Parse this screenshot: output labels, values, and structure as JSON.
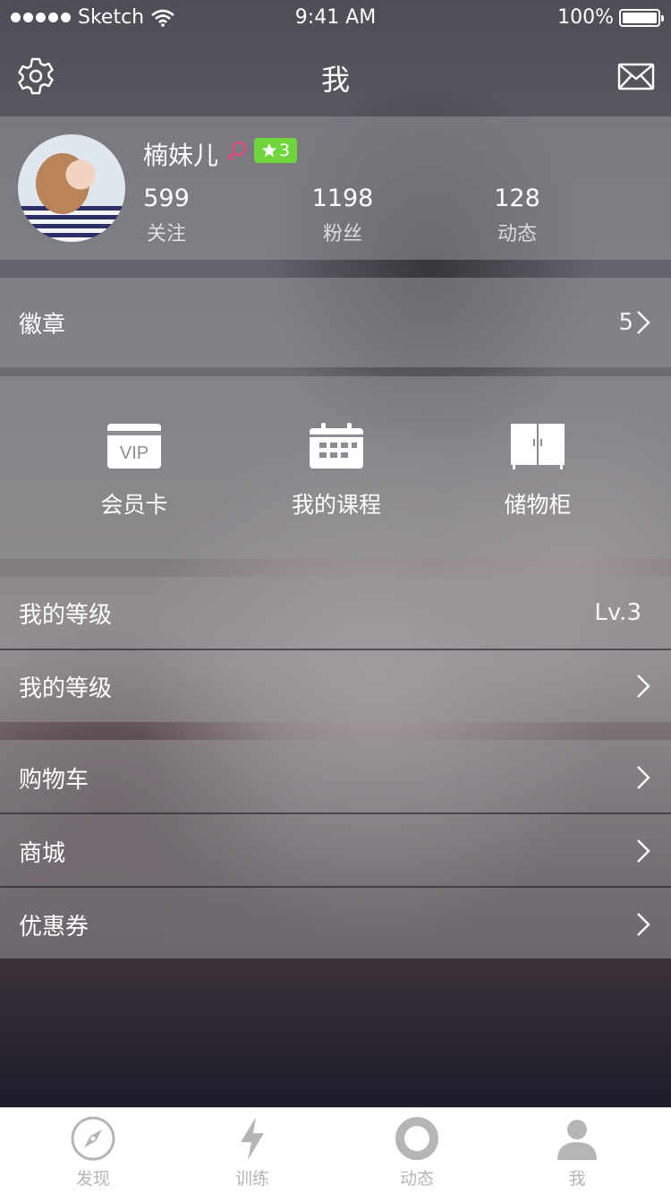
{
  "status_bar": {
    "carrier": "Sketch",
    "time": "9:41 AM",
    "battery": "100%"
  },
  "nav": {
    "title": "我",
    "left_icon": "gear-icon",
    "right_icon": "mail-icon"
  },
  "profile": {
    "name": "楠妹儿",
    "gender_icon": "female-icon",
    "level_badge": "3",
    "stats": [
      {
        "value": "599",
        "label": "关注"
      },
      {
        "value": "1198",
        "label": "粉丝"
      },
      {
        "value": "128",
        "label": "动态"
      }
    ]
  },
  "badges": {
    "label": "徽章",
    "count": "5"
  },
  "grid": [
    {
      "label": "会员卡",
      "icon": "vip-card-icon",
      "icon_text": "VIP"
    },
    {
      "label": "我的课程",
      "icon": "calendar-icon"
    },
    {
      "label": "储物柜",
      "icon": "locker-icon"
    }
  ],
  "level_rows": [
    {
      "label": "我的等级",
      "value": "Lv.3"
    },
    {
      "label": "我的等级"
    }
  ],
  "shop_rows": [
    {
      "label": "购物车"
    },
    {
      "label": "商城"
    },
    {
      "label": "优惠券"
    }
  ],
  "tabbar": [
    {
      "label": "发现",
      "icon": "compass-icon"
    },
    {
      "label": "训练",
      "icon": "lightning-icon"
    },
    {
      "label": "动态",
      "icon": "ring-icon"
    },
    {
      "label": "我",
      "icon": "person-icon"
    }
  ],
  "colors": {
    "badge_green": "#6ed63b",
    "gender_pink": "#e8497f",
    "tab_inactive": "#b5b5b5"
  }
}
